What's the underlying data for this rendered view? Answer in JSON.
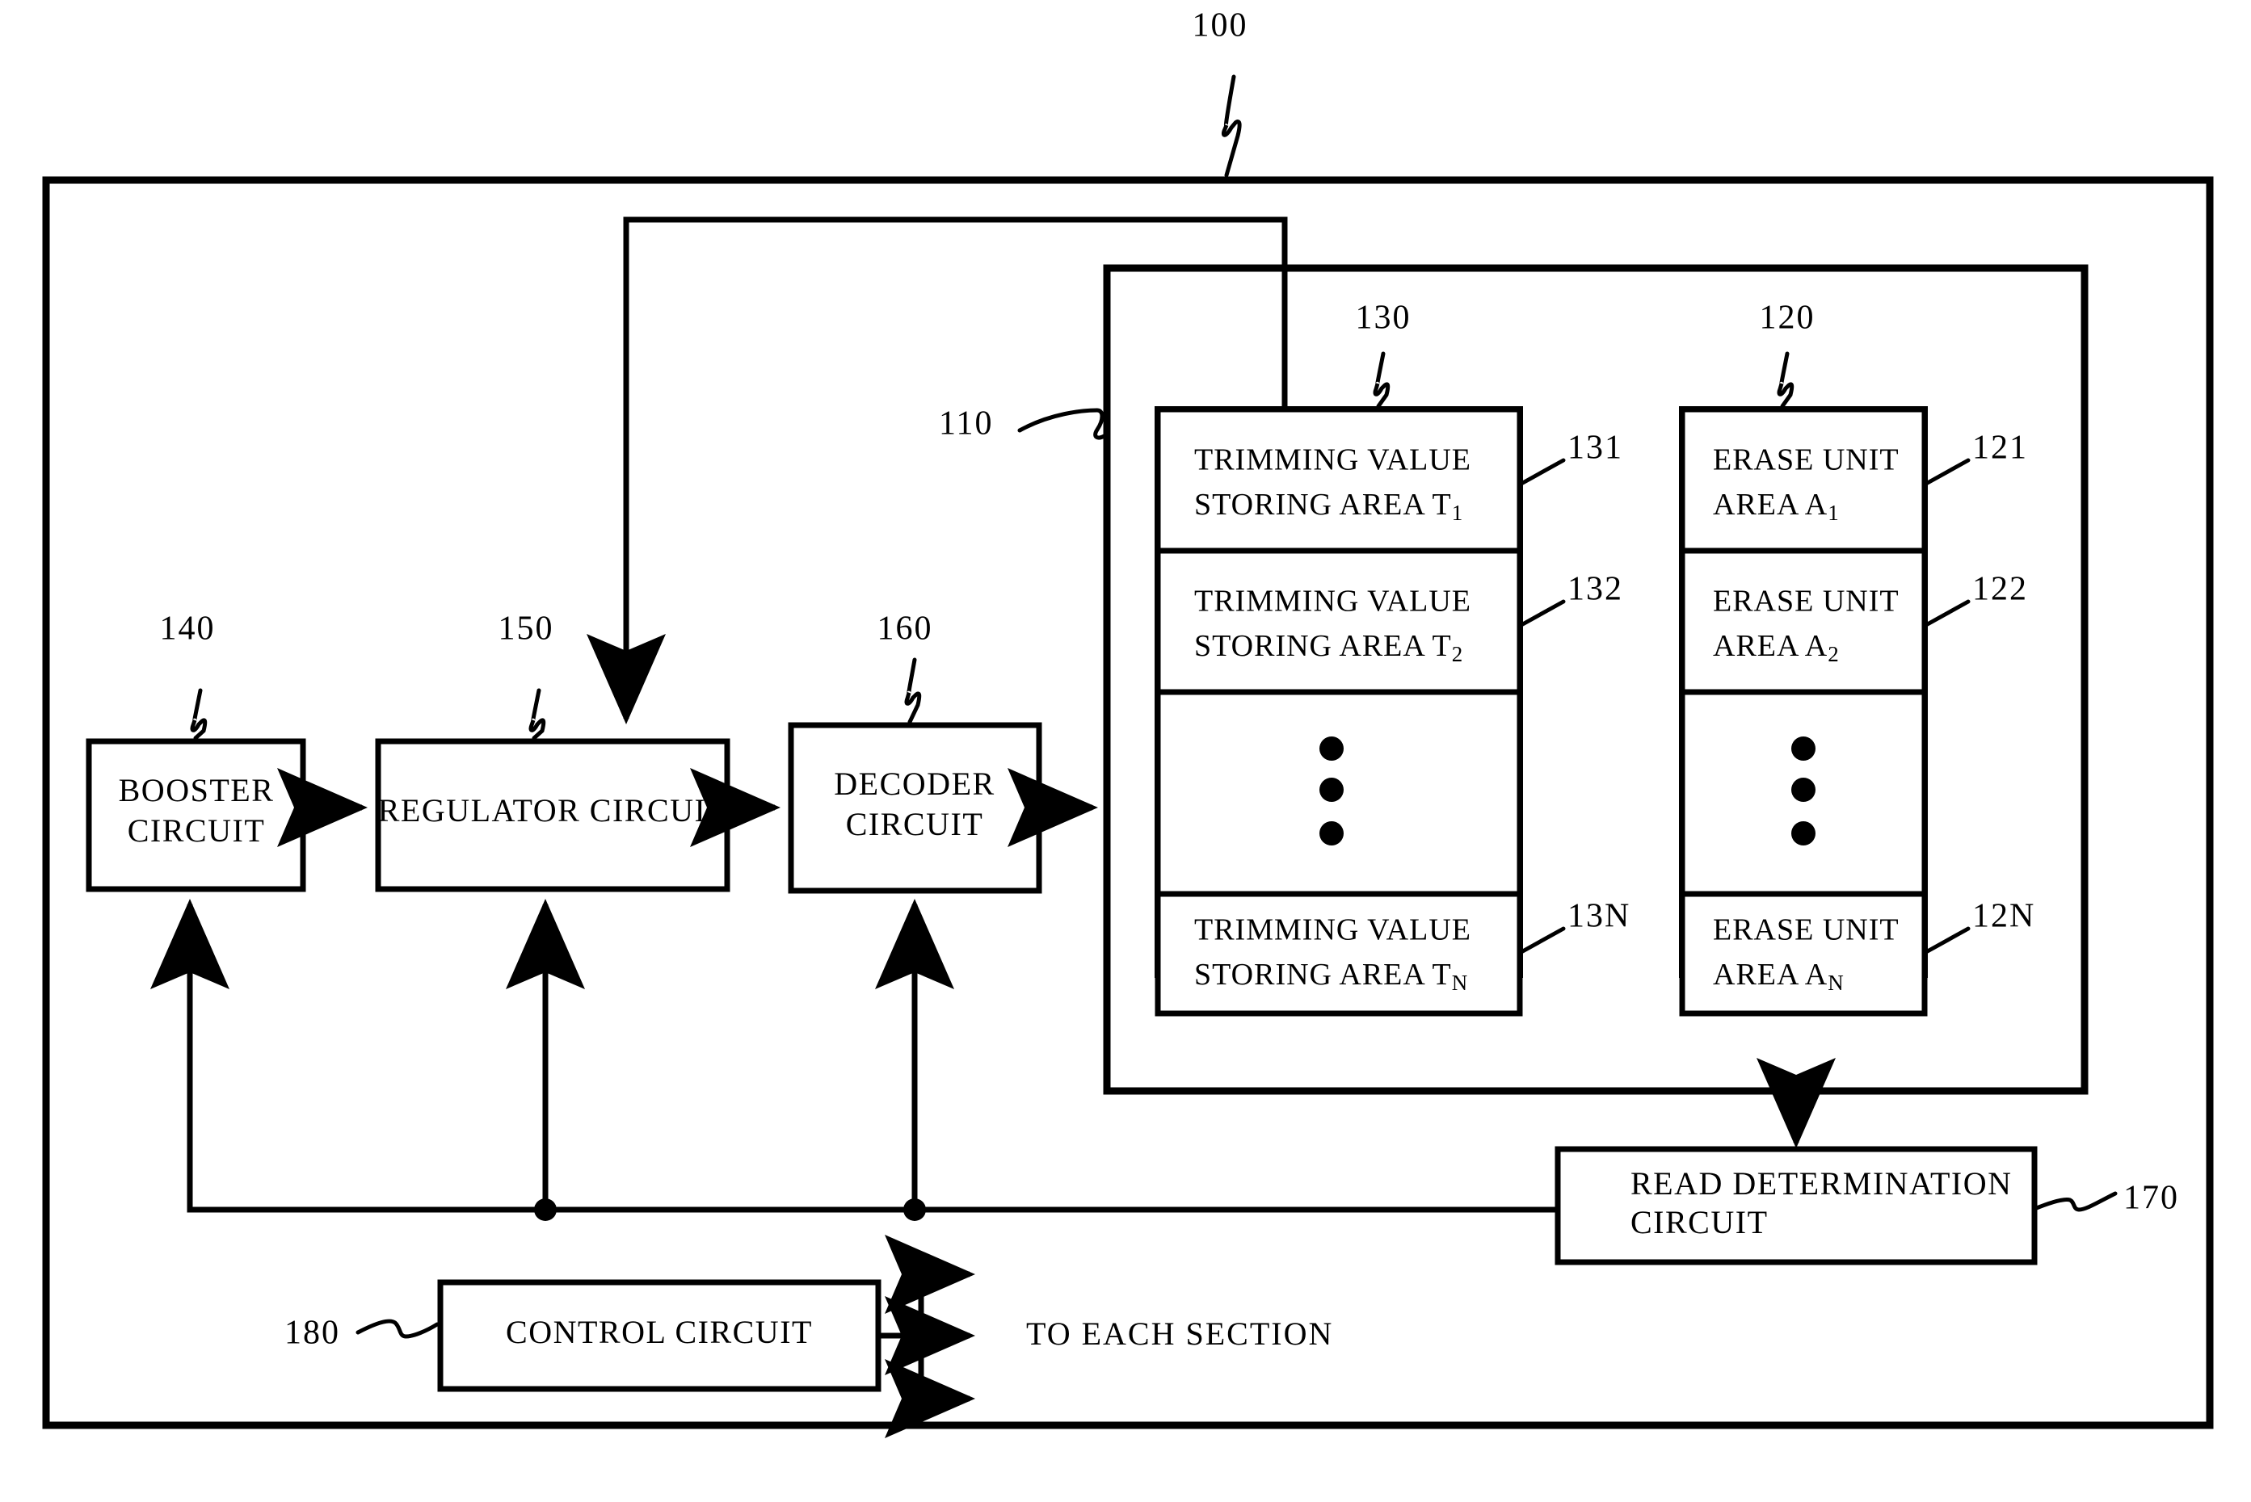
{
  "figure": {
    "root_ref": "100",
    "memory_block_ref": "110",
    "trimming_group_ref": "130",
    "erase_group_ref": "120"
  },
  "blocks": {
    "booster": {
      "ref": "140",
      "line1": "BOOSTER",
      "line2": "CIRCUIT"
    },
    "regulator": {
      "ref": "150",
      "line1": "REGULATOR CIRCUIT",
      "line2": ""
    },
    "decoder": {
      "ref": "160",
      "line1": "DECODER",
      "line2": "CIRCUIT"
    },
    "read_determination": {
      "ref": "170",
      "line1": "READ DETERMINATION",
      "line2": "CIRCUIT"
    },
    "control": {
      "ref": "180",
      "line1": "CONTROL CIRCUIT",
      "line2": ""
    }
  },
  "trimming_cells": [
    {
      "ref": "131",
      "line1": "TRIMMING VALUE",
      "line2_main": "STORING AREA T",
      "line2_sub": "1"
    },
    {
      "ref": "132",
      "line1": "TRIMMING VALUE",
      "line2_main": "STORING AREA T",
      "line2_sub": "2"
    },
    {
      "ref": "13N",
      "line1": "TRIMMING VALUE",
      "line2_main": "STORING AREA T",
      "line2_sub": "N"
    }
  ],
  "erase_cells": [
    {
      "ref": "121",
      "line1": "ERASE UNIT",
      "line2_main": "AREA A",
      "line2_sub": "1"
    },
    {
      "ref": "122",
      "line1": "ERASE UNIT",
      "line2_main": "AREA A",
      "line2_sub": "2"
    },
    {
      "ref": "12N",
      "line1": "ERASE UNIT",
      "line2_main": "AREA A",
      "line2_sub": "N"
    }
  ],
  "annotations": {
    "to_each_section": "TO EACH SECTION"
  },
  "colors": {
    "ink": "#000000",
    "paper": "#ffffff"
  }
}
